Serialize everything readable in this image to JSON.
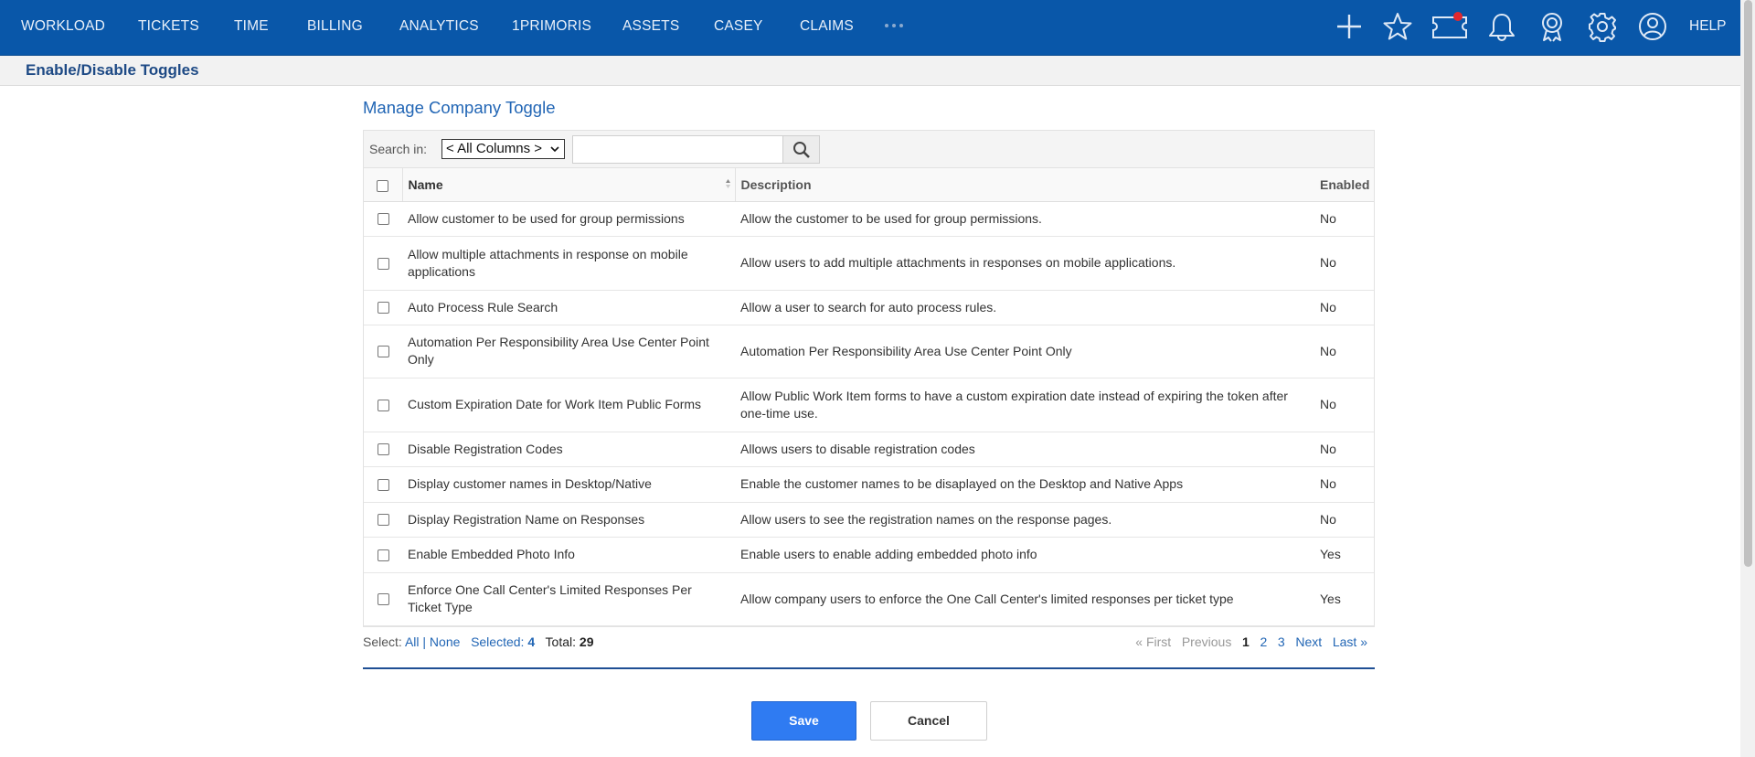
{
  "nav": {
    "items": [
      "WORKLOAD",
      "TICKETS",
      "TIME",
      "BILLING",
      "ANALYTICS",
      "1PRIMORIS",
      "ASSETS",
      "CASEY",
      "CLAIMS"
    ],
    "help": "HELP",
    "icons": [
      "plus-icon",
      "star-icon",
      "ticket-icon",
      "bell-icon",
      "award-icon",
      "gear-icon",
      "user-icon"
    ],
    "notification_dot_color": "#e0282f"
  },
  "page": {
    "title": "Enable/Disable Toggles"
  },
  "section": {
    "title": "Manage Company Toggle"
  },
  "search": {
    "label": "Search in:",
    "column_selected": "< All Columns >",
    "value": ""
  },
  "table": {
    "headers": {
      "name": "Name",
      "description": "Description",
      "enabled": "Enabled"
    },
    "rows": [
      {
        "name": "Allow customer to be used for group permissions",
        "description": "Allow the customer to be used for group permissions.",
        "enabled": "No"
      },
      {
        "name": "Allow multiple attachments in response on mobile applications",
        "description": "Allow users to add multiple attachments in responses on mobile applications.",
        "enabled": "No"
      },
      {
        "name": "Auto Process Rule Search",
        "description": "Allow a user to search for auto process rules.",
        "enabled": "No"
      },
      {
        "name": "Automation Per Responsibility Area Use Center Point Only",
        "description": "Automation Per Responsibility Area Use Center Point Only",
        "enabled": "No"
      },
      {
        "name": "Custom Expiration Date for Work Item Public Forms",
        "description": "Allow Public Work Item forms to have a custom expiration date instead of expiring the token after one-time use.",
        "enabled": "No"
      },
      {
        "name": "Disable Registration Codes",
        "description": "Allows users to disable registration codes",
        "enabled": "No"
      },
      {
        "name": "Display customer names in Desktop/Native",
        "description": "Enable the customer names to be disaplayed on the Desktop and Native Apps",
        "enabled": "No"
      },
      {
        "name": "Display Registration Name on Responses",
        "description": "Allow users to see the registration names on the response pages.",
        "enabled": "No"
      },
      {
        "name": "Enable Embedded Photo Info",
        "description": "Enable users to enable adding embedded photo info",
        "enabled": "Yes"
      },
      {
        "name": "Enforce One Call Center's Limited Responses Per Ticket Type",
        "description": "Allow company users to enforce the One Call Center's limited responses per ticket type",
        "enabled": "Yes"
      }
    ]
  },
  "footer": {
    "select_label": "Select:",
    "all": "All",
    "separator": "|",
    "none": "None",
    "selected_label": "Selected:",
    "selected_count": "4",
    "total_label": "Total:",
    "total_count": "29"
  },
  "pager": {
    "first": "« First",
    "previous": "Previous",
    "pages": [
      "1",
      "2",
      "3"
    ],
    "current": "1",
    "next": "Next",
    "last": "Last »"
  },
  "actions": {
    "save": "Save",
    "cancel": "Cancel"
  },
  "colors": {
    "nav_bg": "#0957a9",
    "accent": "#2266b5",
    "save_bg": "#2f7bf2"
  }
}
